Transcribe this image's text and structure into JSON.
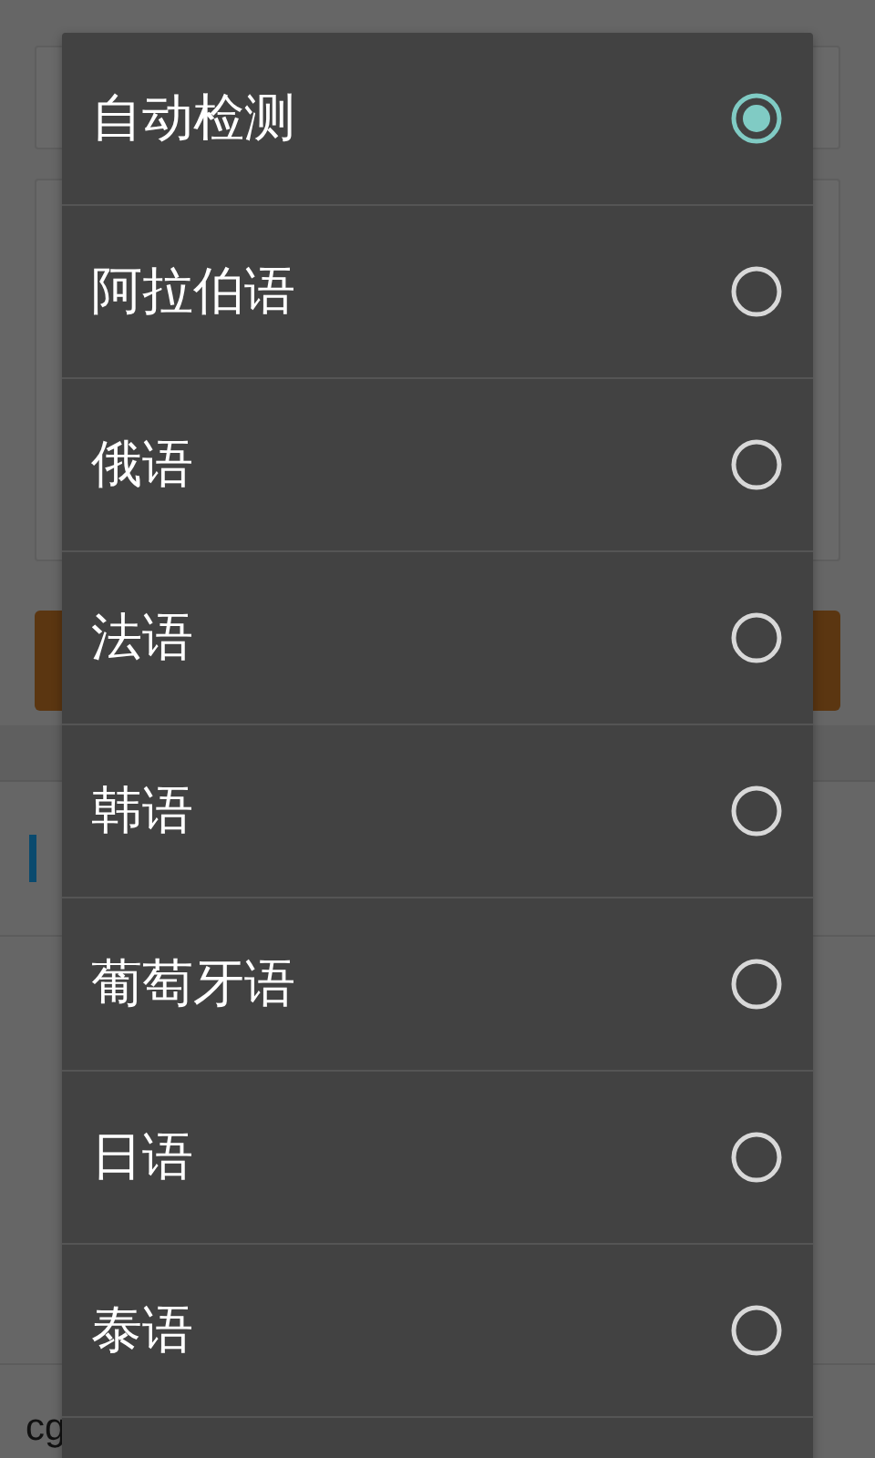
{
  "background": {
    "bottom_text": "cg"
  },
  "dialog": {
    "options": [
      {
        "label": "自动检测",
        "selected": true
      },
      {
        "label": "阿拉伯语",
        "selected": false
      },
      {
        "label": "俄语",
        "selected": false
      },
      {
        "label": "法语",
        "selected": false
      },
      {
        "label": "韩语",
        "selected": false
      },
      {
        "label": "葡萄牙语",
        "selected": false
      },
      {
        "label": "日语",
        "selected": false
      },
      {
        "label": "泰语",
        "selected": false
      }
    ]
  }
}
